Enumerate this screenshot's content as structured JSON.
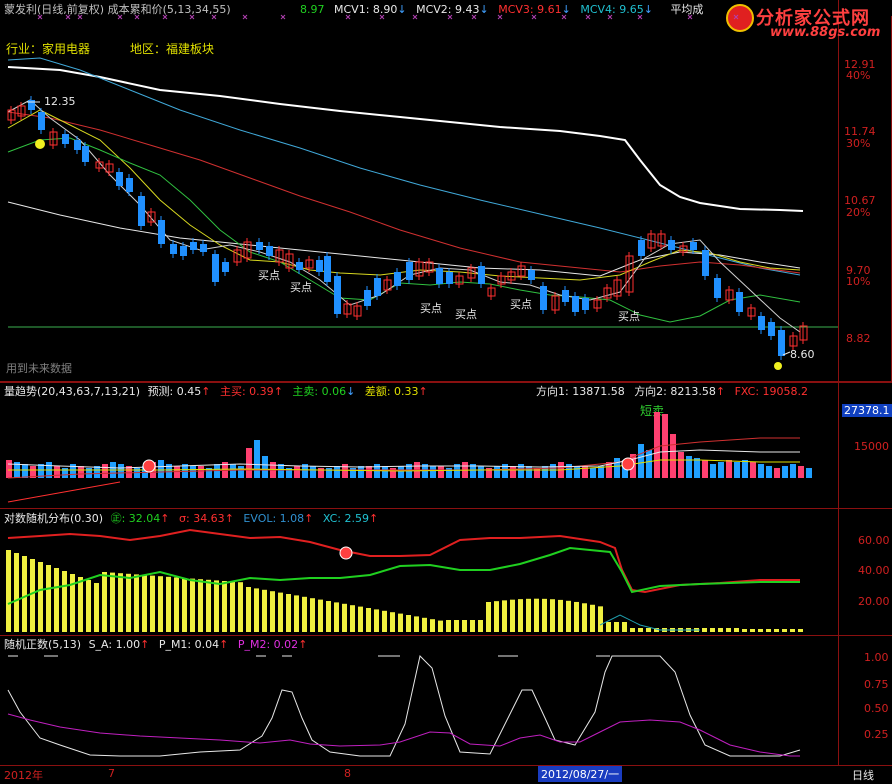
{
  "main_header": {
    "title": "蒙发利(日线,前复权) 成本累和价(5,13,34,55)",
    "mcv0": "8.97",
    "mcv1": "MCV1: 8.90",
    "mcv2": "MCV2: 9.43",
    "mcv3": "MCV3: 9.61",
    "mcv4": "MCV4: 9.65",
    "avg_cost": "平均成"
  },
  "logo": {
    "name": "分析家公式网",
    "url": "www.88gs.com"
  },
  "stock_info": {
    "industry": "行业：家用电器",
    "region": "地区：福建板块"
  },
  "price_axis": {
    "labels": [
      "12.91",
      "11.74",
      "10.67",
      "9.70",
      "8.82"
    ],
    "percents": [
      "40%",
      "30%",
      "20%",
      "10%"
    ]
  },
  "annotations": {
    "high": "12.35",
    "low": "8.60",
    "buy": "买点",
    "future_data": "用到未来数据"
  },
  "volume_header": {
    "title": "量趋势(20,43,63,7,13,21)",
    "forecast": "预测: 0.45",
    "main_buy": "主买: 0.39",
    "main_sell": "主卖: 0.06",
    "diff": "差额: 0.33",
    "dir1": "方向1: 13871.58",
    "dir2": "方向2: 8213.58",
    "fxc": "FXC: 19058.2"
  },
  "volume_axis": {
    "top_value": "27378.1",
    "mid_value": "15000",
    "short_sell": "短卖"
  },
  "dist_header": {
    "title": "对数随机分布(0.30)",
    "mu": "32.04",
    "sigma": "σ: 34.63",
    "evol": "EVOL: 1.08",
    "xc": "XC: 2.59"
  },
  "dist_axis": {
    "labels": [
      "60.00",
      "40.00",
      "20.00"
    ]
  },
  "rand_header": {
    "title": "随机正数(5,13)",
    "sa": "S_A: 1.00",
    "pm1": "P_M1: 0.04",
    "pm2": "P_M2: 0.02"
  },
  "rand_axis": {
    "labels": [
      "1.00",
      "0.75",
      "0.50",
      "0.25"
    ]
  },
  "date_bar": {
    "year": "2012年",
    "m7": "7",
    "m8": "8",
    "cursor": "2012/08/27/一",
    "period": "日线"
  }
}
